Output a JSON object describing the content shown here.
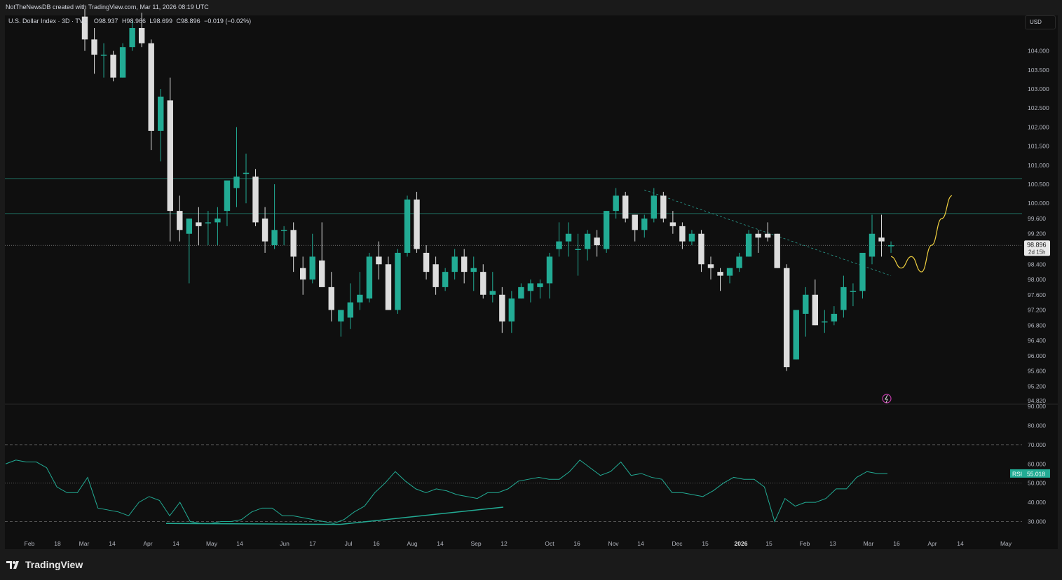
{
  "header": {
    "author_line": "NotTheNewsDB created with TradingView.com, Mar 11, 2026 08:19 UTC"
  },
  "legend": {
    "symbol": "U.S. Dollar Index · 3D · TVC",
    "open": "O98.937",
    "high": "H98.966",
    "low": "L98.699",
    "close": "C98.896",
    "change": "−0.019 (−0.02%)"
  },
  "currency_button": "USD",
  "footer": {
    "brand": "TradingView"
  },
  "colors": {
    "up": "#22ab94",
    "down": "#dddddd",
    "projection": "#f0d040",
    "rsi": "#22ab94",
    "background": "#0f0f0f"
  },
  "chart_data": [
    {
      "type": "candlestick",
      "title": "U.S. Dollar Index",
      "timeframe": "3D",
      "price_axis_labels": [
        "104.000",
        "103.500",
        "103.000",
        "102.500",
        "102.000",
        "101.500",
        "101.000",
        "100.500",
        "100.000",
        "99.600",
        "99.200",
        "98.400",
        "98.000",
        "97.600",
        "97.200",
        "96.800",
        "96.400",
        "96.000",
        "95.600",
        "95.200",
        "94.820"
      ],
      "ylim": [
        94.82,
        104.6
      ],
      "last_price": "98.896",
      "countdown": "2d 15h",
      "time_axis_labels": [
        "Feb",
        "18",
        "Mar",
        "14",
        "Apr",
        "14",
        "May",
        "14",
        "Jun",
        "17",
        "Jul",
        "16",
        "Aug",
        "14",
        "Sep",
        "12",
        "Oct",
        "16",
        "Nov",
        "14",
        "Dec",
        "15",
        "2026",
        "15",
        "Feb",
        "13",
        "Mar",
        "16",
        "Apr",
        "14",
        "May"
      ],
      "candles": [
        {
          "o": 104.9,
          "h": 105.1,
          "l": 104.0,
          "c": 104.3
        },
        {
          "o": 104.3,
          "h": 104.6,
          "l": 103.4,
          "c": 103.9
        },
        {
          "o": 103.9,
          "h": 104.2,
          "l": 103.3,
          "c": 103.9
        },
        {
          "o": 103.9,
          "h": 104.0,
          "l": 103.2,
          "c": 103.3
        },
        {
          "o": 103.3,
          "h": 104.2,
          "l": 103.3,
          "c": 104.1
        },
        {
          "o": 104.1,
          "h": 104.8,
          "l": 104.0,
          "c": 104.6
        },
        {
          "o": 104.6,
          "h": 105.0,
          "l": 104.1,
          "c": 104.2
        },
        {
          "o": 104.2,
          "h": 104.3,
          "l": 101.4,
          "c": 101.9
        },
        {
          "o": 101.9,
          "h": 103.0,
          "l": 101.1,
          "c": 102.8
        },
        {
          "o": 102.7,
          "h": 103.3,
          "l": 99.0,
          "c": 99.8
        },
        {
          "o": 99.8,
          "h": 100.2,
          "l": 99.0,
          "c": 99.3
        },
        {
          "o": 99.2,
          "h": 99.6,
          "l": 97.9,
          "c": 99.6
        },
        {
          "o": 99.5,
          "h": 99.9,
          "l": 98.9,
          "c": 99.4
        },
        {
          "o": 99.5,
          "h": 99.8,
          "l": 98.9,
          "c": 99.5
        },
        {
          "o": 99.5,
          "h": 99.9,
          "l": 98.9,
          "c": 99.6
        },
        {
          "o": 99.8,
          "h": 100.0,
          "l": 99.4,
          "c": 100.6
        },
        {
          "o": 100.4,
          "h": 102.0,
          "l": 99.9,
          "c": 100.7
        },
        {
          "o": 100.8,
          "h": 101.3,
          "l": 100.0,
          "c": 100.8
        },
        {
          "o": 100.7,
          "h": 100.9,
          "l": 99.4,
          "c": 99.5
        },
        {
          "o": 99.6,
          "h": 99.9,
          "l": 98.7,
          "c": 99.0
        },
        {
          "o": 98.9,
          "h": 100.5,
          "l": 98.8,
          "c": 99.3
        },
        {
          "o": 99.3,
          "h": 99.4,
          "l": 98.9,
          "c": 99.3
        },
        {
          "o": 99.3,
          "h": 99.5,
          "l": 98.2,
          "c": 98.6
        },
        {
          "o": 98.3,
          "h": 98.6,
          "l": 97.6,
          "c": 98.0
        },
        {
          "o": 98.0,
          "h": 99.2,
          "l": 97.9,
          "c": 98.6
        },
        {
          "o": 98.5,
          "h": 99.5,
          "l": 97.9,
          "c": 97.8
        },
        {
          "o": 97.8,
          "h": 98.2,
          "l": 96.9,
          "c": 97.2
        },
        {
          "o": 96.9,
          "h": 97.2,
          "l": 96.5,
          "c": 97.2
        },
        {
          "o": 97.0,
          "h": 97.9,
          "l": 96.7,
          "c": 97.4
        },
        {
          "o": 97.4,
          "h": 98.2,
          "l": 97.2,
          "c": 97.6
        },
        {
          "o": 97.5,
          "h": 98.7,
          "l": 97.4,
          "c": 98.6
        },
        {
          "o": 98.6,
          "h": 99.0,
          "l": 98.0,
          "c": 98.4
        },
        {
          "o": 98.4,
          "h": 98.6,
          "l": 97.2,
          "c": 97.2
        },
        {
          "o": 97.2,
          "h": 98.8,
          "l": 97.1,
          "c": 98.7
        },
        {
          "o": 98.7,
          "h": 100.2,
          "l": 98.6,
          "c": 100.1
        },
        {
          "o": 100.1,
          "h": 100.3,
          "l": 98.7,
          "c": 98.8
        },
        {
          "o": 98.7,
          "h": 98.9,
          "l": 98.0,
          "c": 98.2
        },
        {
          "o": 98.4,
          "h": 98.6,
          "l": 97.6,
          "c": 97.8
        },
        {
          "o": 97.8,
          "h": 98.3,
          "l": 97.7,
          "c": 98.2
        },
        {
          "o": 98.2,
          "h": 98.8,
          "l": 98.0,
          "c": 98.6
        },
        {
          "o": 98.6,
          "h": 98.8,
          "l": 97.9,
          "c": 98.2
        },
        {
          "o": 98.2,
          "h": 98.6,
          "l": 97.7,
          "c": 98.3
        },
        {
          "o": 98.2,
          "h": 98.4,
          "l": 97.5,
          "c": 97.6
        },
        {
          "o": 97.6,
          "h": 98.2,
          "l": 97.4,
          "c": 97.7
        },
        {
          "o": 97.6,
          "h": 97.8,
          "l": 96.6,
          "c": 96.9
        },
        {
          "o": 96.9,
          "h": 97.7,
          "l": 96.6,
          "c": 97.5
        },
        {
          "o": 97.5,
          "h": 97.9,
          "l": 97.5,
          "c": 97.8
        },
        {
          "o": 97.7,
          "h": 98.0,
          "l": 97.4,
          "c": 97.9
        },
        {
          "o": 97.8,
          "h": 98.0,
          "l": 97.5,
          "c": 97.9
        },
        {
          "o": 97.9,
          "h": 98.7,
          "l": 97.5,
          "c": 98.6
        },
        {
          "o": 98.8,
          "h": 99.5,
          "l": 98.6,
          "c": 99.0
        },
        {
          "o": 99.0,
          "h": 99.5,
          "l": 98.6,
          "c": 99.2
        },
        {
          "o": 98.8,
          "h": 99.2,
          "l": 98.1,
          "c": 98.8
        },
        {
          "o": 98.8,
          "h": 99.3,
          "l": 98.5,
          "c": 99.2
        },
        {
          "o": 99.1,
          "h": 99.3,
          "l": 98.6,
          "c": 98.9
        },
        {
          "o": 98.8,
          "h": 99.8,
          "l": 98.7,
          "c": 99.8
        },
        {
          "o": 99.8,
          "h": 100.4,
          "l": 99.6,
          "c": 100.2
        },
        {
          "o": 100.2,
          "h": 100.3,
          "l": 99.5,
          "c": 99.6
        },
        {
          "o": 99.7,
          "h": 99.7,
          "l": 99.0,
          "c": 99.3
        },
        {
          "o": 99.3,
          "h": 99.7,
          "l": 99.1,
          "c": 99.6
        },
        {
          "o": 99.6,
          "h": 100.4,
          "l": 99.5,
          "c": 100.2
        },
        {
          "o": 100.2,
          "h": 100.3,
          "l": 99.5,
          "c": 99.6
        },
        {
          "o": 99.5,
          "h": 99.8,
          "l": 99.2,
          "c": 99.4
        },
        {
          "o": 99.4,
          "h": 99.5,
          "l": 98.8,
          "c": 99.0
        },
        {
          "o": 99.0,
          "h": 99.3,
          "l": 98.9,
          "c": 99.2
        },
        {
          "o": 99.2,
          "h": 99.3,
          "l": 98.2,
          "c": 98.4
        },
        {
          "o": 98.4,
          "h": 98.6,
          "l": 98.0,
          "c": 98.3
        },
        {
          "o": 98.2,
          "h": 98.3,
          "l": 97.7,
          "c": 98.1
        },
        {
          "o": 98.1,
          "h": 98.3,
          "l": 97.9,
          "c": 98.3
        },
        {
          "o": 98.3,
          "h": 98.7,
          "l": 98.2,
          "c": 98.6
        },
        {
          "o": 98.6,
          "h": 99.3,
          "l": 98.6,
          "c": 99.2
        },
        {
          "o": 99.2,
          "h": 99.3,
          "l": 98.7,
          "c": 99.1
        },
        {
          "o": 99.2,
          "h": 99.5,
          "l": 99.0,
          "c": 99.1
        },
        {
          "o": 99.2,
          "h": 99.2,
          "l": 98.3,
          "c": 98.3
        },
        {
          "o": 98.3,
          "h": 98.4,
          "l": 95.6,
          "c": 95.7
        },
        {
          "o": 95.9,
          "h": 97.2,
          "l": 95.9,
          "c": 97.2
        },
        {
          "o": 97.1,
          "h": 97.8,
          "l": 96.5,
          "c": 97.6
        },
        {
          "o": 97.6,
          "h": 98.0,
          "l": 96.8,
          "c": 96.8
        },
        {
          "o": 96.9,
          "h": 97.2,
          "l": 96.6,
          "c": 96.9
        },
        {
          "o": 96.9,
          "h": 97.3,
          "l": 96.8,
          "c": 97.1
        },
        {
          "o": 97.2,
          "h": 98.1,
          "l": 97.0,
          "c": 97.8
        },
        {
          "o": 97.7,
          "h": 97.9,
          "l": 97.3,
          "c": 97.7
        },
        {
          "o": 97.7,
          "h": 98.5,
          "l": 97.5,
          "c": 98.7
        },
        {
          "o": 98.6,
          "h": 99.7,
          "l": 98.4,
          "c": 99.2
        },
        {
          "o": 99.1,
          "h": 99.7,
          "l": 98.6,
          "c": 99.0
        },
        {
          "o": 98.9,
          "h": 99.0,
          "l": 98.7,
          "c": 98.9
        }
      ],
      "projection": [
        98.6,
        98.3,
        98.6,
        98.2,
        98.9,
        99.6,
        100.2
      ],
      "resistance_levels": [
        100.65,
        99.73
      ],
      "trendline": {
        "from": 100.35,
        "to": 98.1
      }
    },
    {
      "type": "line",
      "title": "RSI",
      "value": "55.018",
      "axis_labels": [
        "90.000",
        "80.000",
        "70.000",
        "60.000",
        "50.000",
        "40.000",
        "30.000"
      ],
      "ylim": [
        28,
        90
      ],
      "bands": [
        70,
        50,
        30
      ],
      "values": [
        60,
        62,
        61,
        61,
        58,
        48,
        45,
        45,
        53,
        37,
        36,
        35,
        33,
        40,
        43,
        41,
        33,
        40,
        30,
        29,
        29,
        30,
        30,
        31,
        35,
        37,
        37,
        33,
        33,
        32,
        31,
        30,
        29,
        31,
        35,
        38,
        45,
        50,
        56,
        51,
        47,
        45,
        47,
        46,
        44,
        43,
        42,
        45,
        45,
        47,
        51,
        52,
        53,
        52,
        52,
        56,
        62,
        58,
        54,
        56,
        61,
        54,
        55,
        53,
        52,
        45,
        45,
        44,
        43,
        46,
        50,
        53,
        52,
        52,
        48,
        30,
        42,
        38,
        40,
        40,
        42,
        47,
        47,
        53,
        56,
        55,
        55
      ]
    }
  ]
}
